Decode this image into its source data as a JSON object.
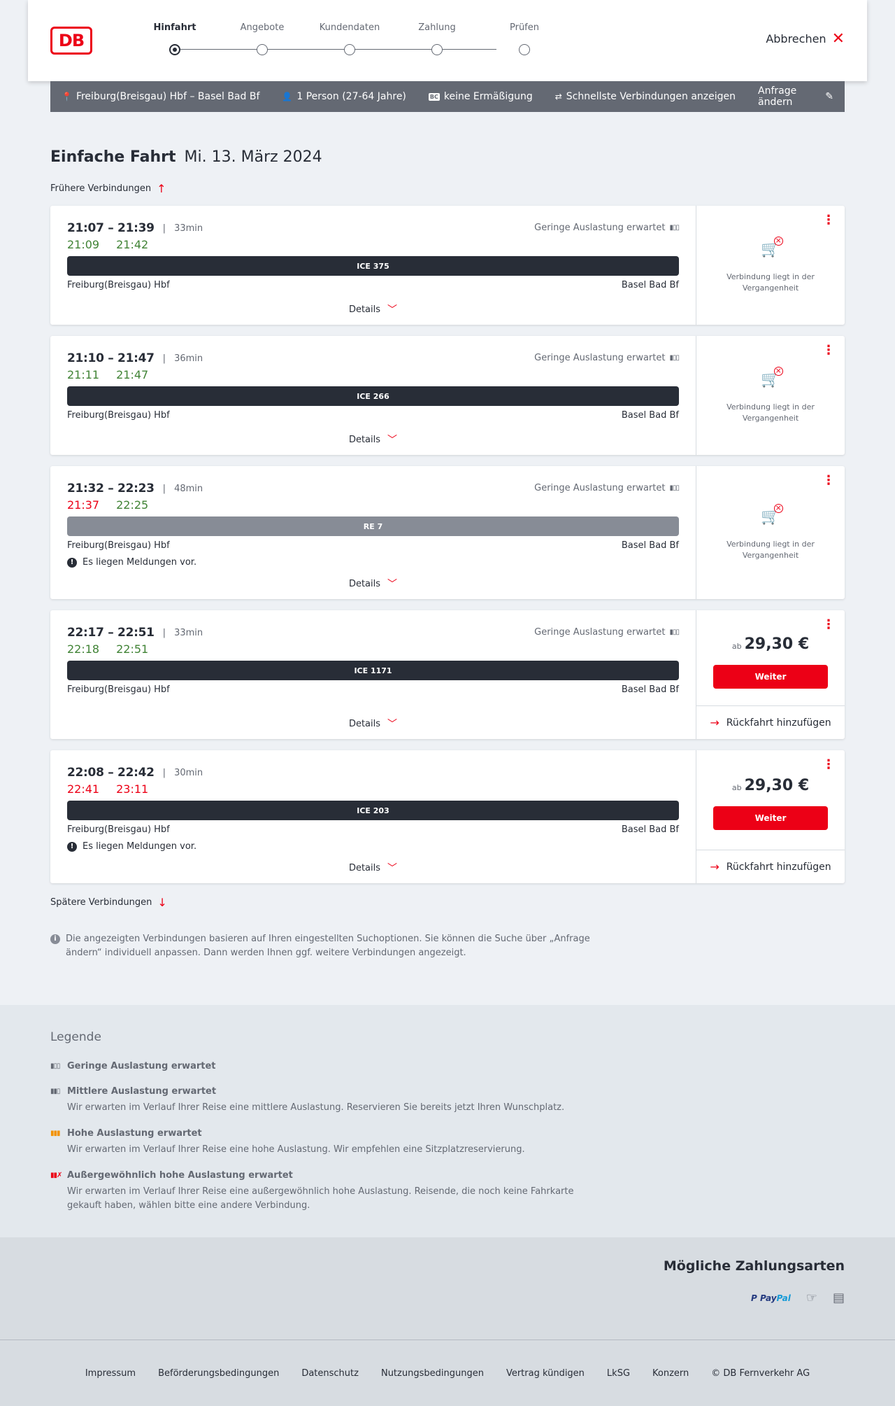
{
  "header": {
    "logo": "DB",
    "steps": [
      {
        "label": "Hinfahrt",
        "active": true
      },
      {
        "label": "Angebote",
        "active": false
      },
      {
        "label": "Kundendaten",
        "active": false
      },
      {
        "label": "Zahlung",
        "active": false
      },
      {
        "label": "Prüfen",
        "active": false
      }
    ],
    "cancel_label": "Abbrechen"
  },
  "summary": {
    "route": "Freiburg(Breisgau) Hbf – Basel Bad Bf",
    "travellers": "1 Person (27-64 Jahre)",
    "discount_badge": "BC",
    "discount": "keine Ermäßigung",
    "option": "Schnellste Verbindungen anzeigen",
    "edit_label": "Anfrage ändern"
  },
  "main": {
    "trip_type": "Einfache Fahrt",
    "date": "Mi. 13. März 2024",
    "earlier_label": "Frühere Verbindungen",
    "later_label": "Spätere Verbindungen",
    "info_text": "Die angezeigten Verbindungen basieren auf Ihren eingestellten Suchoptionen. Sie können die Suche über „Anfrage ändern“ individuell anpassen. Dann werden Ihnen ggf. weitere Verbindungen angezeigt."
  },
  "connections": [
    {
      "times": "21:07 – 21:39",
      "duration": "33min",
      "rt_dep": "21:09",
      "rt_dep_status": "ok",
      "rt_arr": "21:42",
      "rt_arr_status": "ok",
      "load": "Geringe Auslastung erwartet",
      "train": "ICE 375",
      "train_kind": "long",
      "from": "Freiburg(Breisgau) Hbf",
      "to": "Basel Bad Bf",
      "message": "",
      "details_label": "Details",
      "past_text": "Verbindung liegt in der Vergangenheit",
      "price_prefix": "",
      "price": "",
      "button": "",
      "return_label": ""
    },
    {
      "times": "21:10 – 21:47",
      "duration": "36min",
      "rt_dep": "21:11",
      "rt_dep_status": "ok",
      "rt_arr": "21:47",
      "rt_arr_status": "ok",
      "load": "Geringe Auslastung erwartet",
      "train": "ICE 266",
      "train_kind": "long",
      "from": "Freiburg(Breisgau) Hbf",
      "to": "Basel Bad Bf",
      "message": "",
      "details_label": "Details",
      "past_text": "Verbindung liegt in der Vergangenheit",
      "price_prefix": "",
      "price": "",
      "button": "",
      "return_label": ""
    },
    {
      "times": "21:32 – 22:23",
      "duration": "48min",
      "rt_dep": "21:37",
      "rt_dep_status": "late",
      "rt_arr": "22:25",
      "rt_arr_status": "ok",
      "load": "Geringe Auslastung erwartet",
      "train": "RE 7",
      "train_kind": "regional",
      "from": "Freiburg(Breisgau) Hbf",
      "to": "Basel Bad Bf",
      "message": "Es liegen Meldungen vor.",
      "details_label": "Details",
      "past_text": "Verbindung liegt in der Vergangenheit",
      "price_prefix": "",
      "price": "",
      "button": "",
      "return_label": ""
    },
    {
      "times": "22:17 – 22:51",
      "duration": "33min",
      "rt_dep": "22:18",
      "rt_dep_status": "ok",
      "rt_arr": "22:51",
      "rt_arr_status": "ok",
      "load": "Geringe Auslastung erwartet",
      "train": "ICE 1171",
      "train_kind": "long",
      "from": "Freiburg(Breisgau) Hbf",
      "to": "Basel Bad Bf",
      "message": "",
      "details_label": "Details",
      "past_text": "",
      "price_prefix": "ab",
      "price": "29,30 €",
      "button": "Weiter",
      "return_label": "Rückfahrt hinzufügen"
    },
    {
      "times": "22:08 – 22:42",
      "duration": "30min",
      "rt_dep": "22:41",
      "rt_dep_status": "late",
      "rt_arr": "23:11",
      "rt_arr_status": "late",
      "load": "",
      "train": "ICE 203",
      "train_kind": "long",
      "from": "Freiburg(Breisgau) Hbf",
      "to": "Basel Bad Bf",
      "message": "Es liegen Meldungen vor.",
      "details_label": "Details",
      "past_text": "",
      "price_prefix": "ab",
      "price": "29,30 €",
      "button": "Weiter",
      "return_label": "Rückfahrt hinzufügen"
    }
  ],
  "legend": {
    "title": "Legende",
    "items": [
      {
        "title": "Geringe Auslastung erwartet",
        "desc": "",
        "color": "#646973"
      },
      {
        "title": "Mittlere Auslastung erwartet",
        "desc": "Wir erwarten im Verlauf Ihrer Reise eine mittlere Auslastung. Reservieren Sie bereits jetzt Ihren Wunschplatz.",
        "color": "#646973"
      },
      {
        "title": "Hohe Auslastung erwartet",
        "desc": "Wir erwarten im Verlauf Ihrer Reise eine hohe Auslastung. Wir empfehlen eine Sitzplatzreservierung.",
        "color": "#f39200"
      },
      {
        "title": "Außergewöhnlich hohe Auslastung erwartet",
        "desc": "Wir erwarten im Verlauf Ihrer Reise eine außergewöhnlich hohe Auslastung. Reisende, die noch keine Fahrkarte gekauft haben, wählen bitte eine andere Verbindung.",
        "color": "#ec0016"
      }
    ]
  },
  "payment": {
    "title": "Mögliche Zahlungsarten",
    "paypal_a": "Pay",
    "paypal_b": "Pal",
    "sepa_label": "SEPA"
  },
  "footer": {
    "links": [
      "Impressum",
      "Beförderungsbedingungen",
      "Datenschutz",
      "Nutzungsbedingungen",
      "Vertrag kündigen",
      "LkSG",
      "Konzern",
      "© DB Fernverkehr AG"
    ]
  },
  "colors": {
    "brand": "#ec0016",
    "ontime": "#408335",
    "late": "#ec0016",
    "long_distance_bar": "#282d37",
    "regional_bar": "#878c96"
  }
}
